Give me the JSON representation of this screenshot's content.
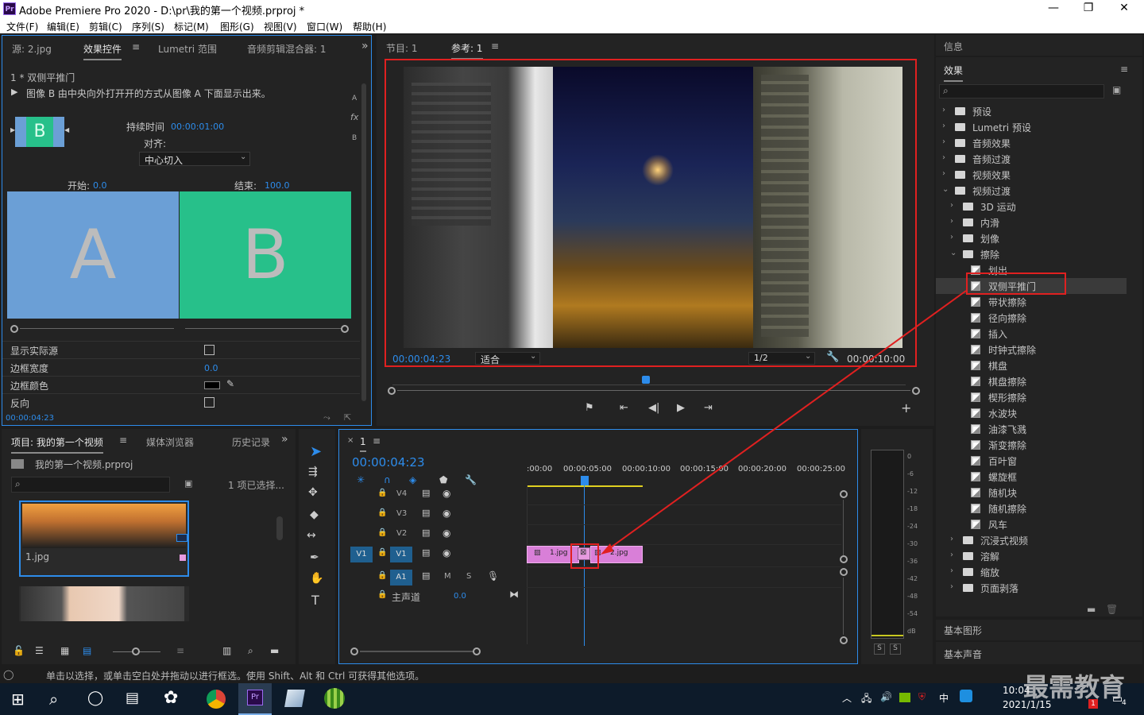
{
  "window": {
    "title": "Adobe Premiere Pro 2020 - D:\\pr\\我的第一个视频.prproj *",
    "app_icon": "Pr",
    "min": "—",
    "max": "❐",
    "close": "✕"
  },
  "menu": [
    "文件(F)",
    "编辑(E)",
    "剪辑(C)",
    "序列(S)",
    "标记(M)",
    "图形(G)",
    "视图(V)",
    "窗口(W)",
    "帮助(H)"
  ],
  "source_panel": {
    "tabs": [
      "源: 2.jpg",
      "效果控件",
      "Lumetri 范围",
      "音频剪辑混合器: 1"
    ],
    "menu_glyph": "≡",
    "overflow": "»",
    "clip_name": "1 * 双侧平推门",
    "description": "图像 B 由中央向外打开开的方式从图像 A 下面显示出来。",
    "duration_label": "持续时间",
    "duration_value": "00:00:01:00",
    "align_label": "对齐:",
    "align_value": "中心切入",
    "thumb_letter": "B",
    "start_label": "开始:",
    "start_value": "0.0",
    "end_label": "结束:",
    "end_value": "100.0",
    "preview_a": "A",
    "preview_b": "B",
    "side_letters": [
      "A",
      "fx",
      "B"
    ],
    "props": [
      {
        "label": "显示实际源",
        "type": "checkbox"
      },
      {
        "label": "边框宽度",
        "value": "0.0"
      },
      {
        "label": "边框颜色",
        "type": "color"
      },
      {
        "label": "反向",
        "type": "checkbox"
      }
    ],
    "timecode": "00:00:04:23"
  },
  "program_panel": {
    "tabs": [
      "节目: 1",
      "参考: 1"
    ],
    "timecode_left": "00:00:04:23",
    "fit_value": "适合",
    "resolution": "1/2",
    "timecode_right": "00:00:10:00",
    "controls": [
      "mark-in",
      "step-back",
      "play",
      "step-forward",
      "go-out"
    ],
    "add": "+"
  },
  "project_panel": {
    "tabs": [
      "项目: 我的第一个视频",
      "媒体浏览器",
      "历史记录"
    ],
    "project_file": "我的第一个视频.prproj",
    "selection": "1 项已选择...",
    "items": [
      {
        "name": "1.jpg"
      }
    ]
  },
  "timeline": {
    "tab": "1",
    "timecode": "00:00:04:23",
    "ruler": [
      ":00:00",
      "00:00:05:00",
      "00:00:10:00",
      "00:00:15:00",
      "00:00:20:00",
      "00:00:25:00"
    ],
    "tracks": [
      {
        "name": "V4"
      },
      {
        "name": "V3"
      },
      {
        "name": "V2"
      },
      {
        "name": "V1",
        "target": "V1"
      },
      {
        "name": "A1",
        "m": "M",
        "s": "S"
      }
    ],
    "master_label": "主声道",
    "master_value": "0.0",
    "clips": [
      {
        "name": "1.jpg"
      },
      {
        "name": "2.jpg"
      }
    ]
  },
  "meter": {
    "scale": [
      "0",
      "-6",
      "-12",
      "-18",
      "-24",
      "-30",
      "-36",
      "-42",
      "-48",
      "-54",
      "dB"
    ],
    "solo": [
      "S",
      "S"
    ]
  },
  "effects_panel": {
    "info_label": "信息",
    "title": "效果",
    "tree": [
      {
        "label": "预设",
        "depth": 0,
        "kind": "folder",
        "chev": "›"
      },
      {
        "label": "Lumetri 预设",
        "depth": 0,
        "kind": "folder",
        "chev": "›"
      },
      {
        "label": "音频效果",
        "depth": 0,
        "kind": "folder",
        "chev": "›"
      },
      {
        "label": "音频过渡",
        "depth": 0,
        "kind": "folder",
        "chev": "›"
      },
      {
        "label": "视频效果",
        "depth": 0,
        "kind": "folder",
        "chev": "›"
      },
      {
        "label": "视频过渡",
        "depth": 0,
        "kind": "folder",
        "chev": "⌄"
      },
      {
        "label": "3D 运动",
        "depth": 1,
        "kind": "folder",
        "chev": "›"
      },
      {
        "label": "内滑",
        "depth": 1,
        "kind": "folder",
        "chev": "›"
      },
      {
        "label": "划像",
        "depth": 1,
        "kind": "folder",
        "chev": "›"
      },
      {
        "label": "擦除",
        "depth": 1,
        "kind": "folder",
        "chev": "⌄"
      },
      {
        "label": "划出",
        "depth": 2,
        "kind": "effect"
      },
      {
        "label": "双侧平推门",
        "depth": 2,
        "kind": "effect",
        "selected": true
      },
      {
        "label": "带状擦除",
        "depth": 2,
        "kind": "effect"
      },
      {
        "label": "径向擦除",
        "depth": 2,
        "kind": "effect"
      },
      {
        "label": "插入",
        "depth": 2,
        "kind": "effect"
      },
      {
        "label": "时钟式擦除",
        "depth": 2,
        "kind": "effect"
      },
      {
        "label": "棋盘",
        "depth": 2,
        "kind": "effect"
      },
      {
        "label": "棋盘擦除",
        "depth": 2,
        "kind": "effect"
      },
      {
        "label": "楔形擦除",
        "depth": 2,
        "kind": "effect"
      },
      {
        "label": "水波块",
        "depth": 2,
        "kind": "effect"
      },
      {
        "label": "油漆飞溅",
        "depth": 2,
        "kind": "effect"
      },
      {
        "label": "渐变擦除",
        "depth": 2,
        "kind": "effect"
      },
      {
        "label": "百叶窗",
        "depth": 2,
        "kind": "effect"
      },
      {
        "label": "螺旋框",
        "depth": 2,
        "kind": "effect"
      },
      {
        "label": "随机块",
        "depth": 2,
        "kind": "effect"
      },
      {
        "label": "随机擦除",
        "depth": 2,
        "kind": "effect"
      },
      {
        "label": "风车",
        "depth": 2,
        "kind": "effect"
      },
      {
        "label": "沉浸式视频",
        "depth": 1,
        "kind": "folder",
        "chev": "›"
      },
      {
        "label": "溶解",
        "depth": 1,
        "kind": "folder",
        "chev": "›"
      },
      {
        "label": "缩放",
        "depth": 1,
        "kind": "folder",
        "chev": "›"
      },
      {
        "label": "页面剥落",
        "depth": 1,
        "kind": "folder",
        "chev": "›"
      }
    ],
    "bottom_panels": [
      "基本图形",
      "基本声音"
    ]
  },
  "status": {
    "text": "单击以选择，或单击空白处并拖动以进行框选。使用 Shift、Alt 和 Ctrl 可获得其他选项。"
  },
  "taskbar": {
    "time": "10:04",
    "date": "2021/1/15",
    "ime": "中",
    "watermark": "最需教育",
    "notif_count": "4",
    "badge": "1"
  },
  "colors": {
    "accent": "#2d8ceb",
    "highlight_red": "#e02020",
    "transition_pink": "#e79ae0",
    "clip_pink": "#d97fd8",
    "thumb_green": "#27c08a",
    "thumb_blue": "#6b9fd6"
  }
}
